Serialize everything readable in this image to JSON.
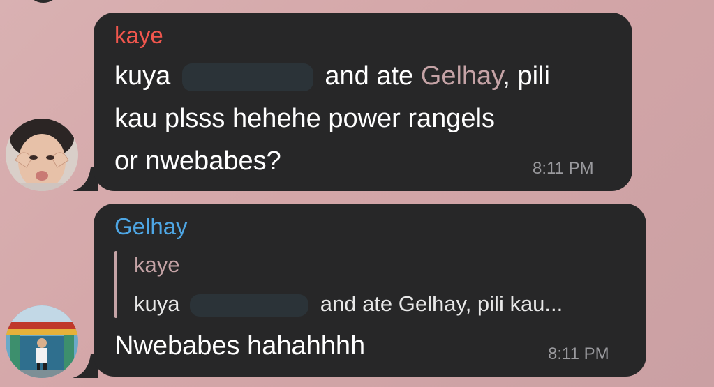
{
  "messages": [
    {
      "sender": "kaye",
      "sender_color": "#f0564d",
      "line1_before": "kuya",
      "line1_after": "and ate",
      "mention": "Gelhay",
      "line1_end": ", pili",
      "line2": "kau plsss hehehe power rangels",
      "line3": "or nwebabes?",
      "time": "8:11 PM",
      "avatar_icon": "profile-photo"
    },
    {
      "sender": "Gelhay",
      "sender_color": "#4ea6e4",
      "reply_sender": "kaye",
      "reply_before": "kuya",
      "reply_after": "and ate Gelhay, pili kau...",
      "text": "Nwebabes hahahhhh",
      "time": "8:11 PM",
      "avatar_icon": "profile-photo"
    }
  ],
  "colors": {
    "background": "#d4a6a8",
    "bubble": "#272728",
    "mention": "#c5a3a6",
    "redaction": "#2b3338",
    "time": "#9a9a9e"
  }
}
